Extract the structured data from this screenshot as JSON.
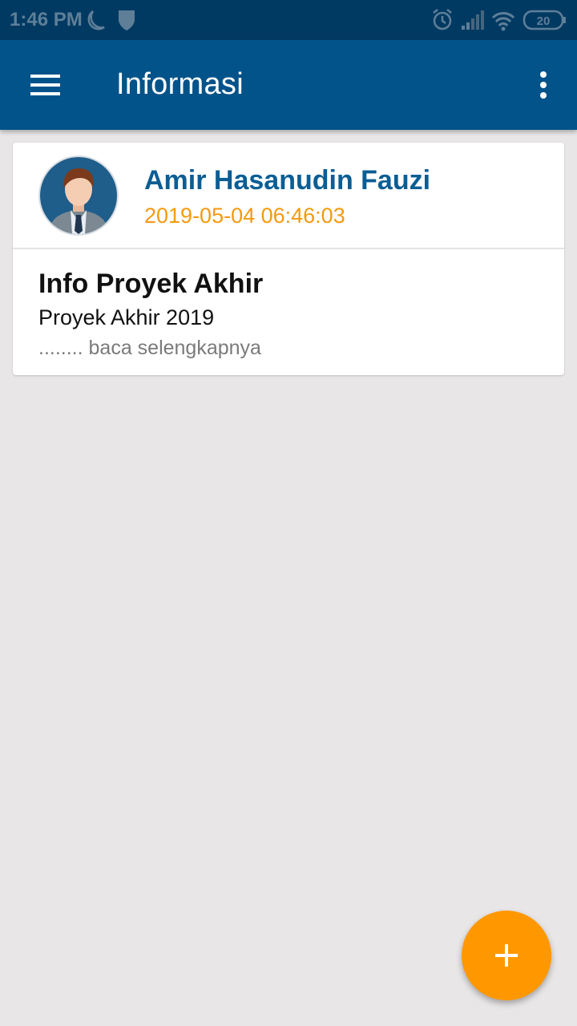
{
  "status_bar": {
    "time": "1:46 PM",
    "battery_level": "20",
    "icons": [
      "moon-icon",
      "shield-icon",
      "alarm-icon",
      "signal-icon",
      "wifi-icon",
      "battery-icon"
    ]
  },
  "app_bar": {
    "title": "Informasi",
    "menu_icon": "hamburger-menu-icon",
    "overflow_icon": "more-vert-icon",
    "color": "#02538a"
  },
  "posts": [
    {
      "author": "Amir Hasanudin Fauzi",
      "datetime": "2019-05-04 06:46:03",
      "title": "Info Proyek Akhir",
      "subtitle": "Proyek Akhir 2019",
      "read_more": "........ baca selengkapnya"
    }
  ],
  "fab": {
    "icon": "plus-icon",
    "color": "#ff9800"
  },
  "colors": {
    "status_bar": "#003a62",
    "author_name": "#0b5e94",
    "date": "#f39a11",
    "background": "#e8e6e7"
  }
}
